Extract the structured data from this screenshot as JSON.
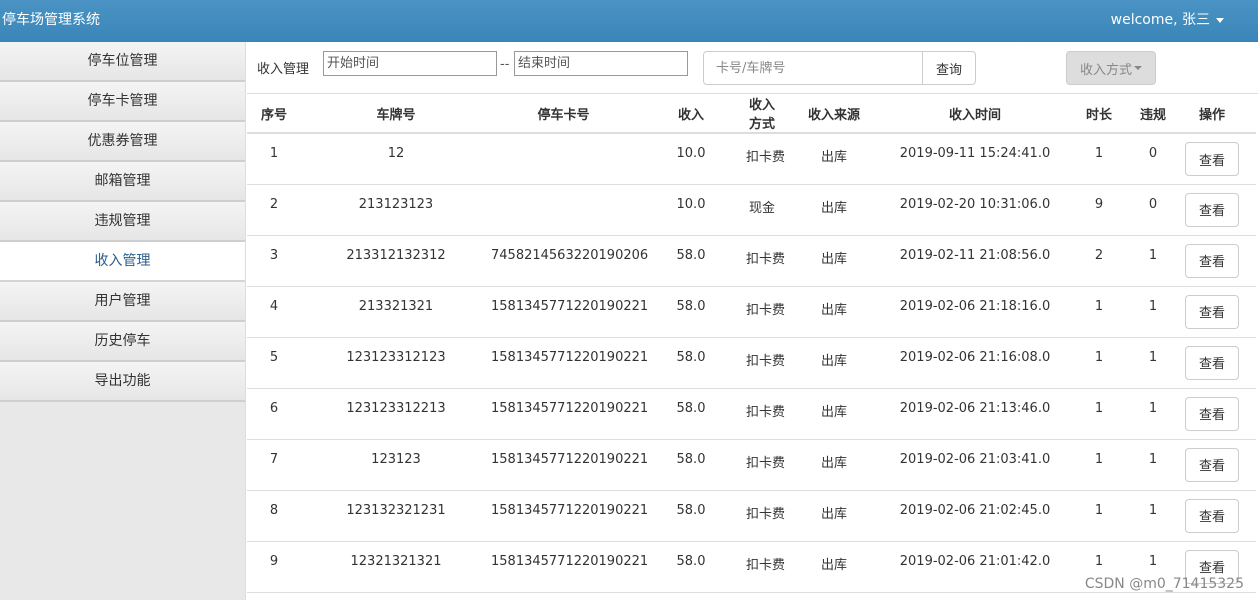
{
  "header": {
    "brand": "停车场管理系统",
    "welcome": "welcome, 张三"
  },
  "sidebar": {
    "items": [
      {
        "label": "停车位管理"
      },
      {
        "label": "停车卡管理"
      },
      {
        "label": "优惠券管理"
      },
      {
        "label": "邮箱管理"
      },
      {
        "label": "违规管理"
      },
      {
        "label": "收入管理",
        "active": true
      },
      {
        "label": "用户管理"
      },
      {
        "label": "历史停车"
      },
      {
        "label": "导出功能"
      }
    ]
  },
  "filter": {
    "label": "收入管理",
    "start_placeholder": "开始时间",
    "separator": "--",
    "end_placeholder": "结束时间",
    "search_placeholder": "卡号/车牌号",
    "search_button": "查询",
    "income_type_button": "收入方式"
  },
  "table": {
    "columns": [
      "序号",
      "车牌号",
      "停车卡号",
      "收入",
      "收入方式",
      "收入来源",
      "收入时间",
      "时长",
      "违规",
      "操作"
    ],
    "view_label": "查看",
    "rows": [
      [
        "1",
        "12",
        "",
        "10.0",
        "扣卡费",
        "出库",
        "2019-09-11 15:24:41.0",
        "1",
        "0"
      ],
      [
        "2",
        "213123123",
        "",
        "10.0",
        "现金",
        "出库",
        "2019-02-20 10:31:06.0",
        "9",
        "0"
      ],
      [
        "3",
        "213312132312",
        "7458214563220190206",
        "58.0",
        "扣卡费",
        "出库",
        "2019-02-11 21:08:56.0",
        "2",
        "1"
      ],
      [
        "4",
        "213321321",
        "1581345771220190221",
        "58.0",
        "扣卡费",
        "出库",
        "2019-02-06 21:18:16.0",
        "1",
        "1"
      ],
      [
        "5",
        "123123312123",
        "1581345771220190221",
        "58.0",
        "扣卡费",
        "出库",
        "2019-02-06 21:16:08.0",
        "1",
        "1"
      ],
      [
        "6",
        "123123312213",
        "1581345771220190221",
        "58.0",
        "扣卡费",
        "出库",
        "2019-02-06 21:13:46.0",
        "1",
        "1"
      ],
      [
        "7",
        "123123",
        "1581345771220190221",
        "58.0",
        "扣卡费",
        "出库",
        "2019-02-06 21:03:41.0",
        "1",
        "1"
      ],
      [
        "8",
        "123132321231",
        "1581345771220190221",
        "58.0",
        "扣卡费",
        "出库",
        "2019-02-06 21:02:45.0",
        "1",
        "1"
      ],
      [
        "9",
        "12321321321",
        "1581345771220190221",
        "58.0",
        "扣卡费",
        "出库",
        "2019-02-06 21:01:42.0",
        "1",
        "1"
      ]
    ]
  },
  "watermark": "CSDN @m0_71415325"
}
